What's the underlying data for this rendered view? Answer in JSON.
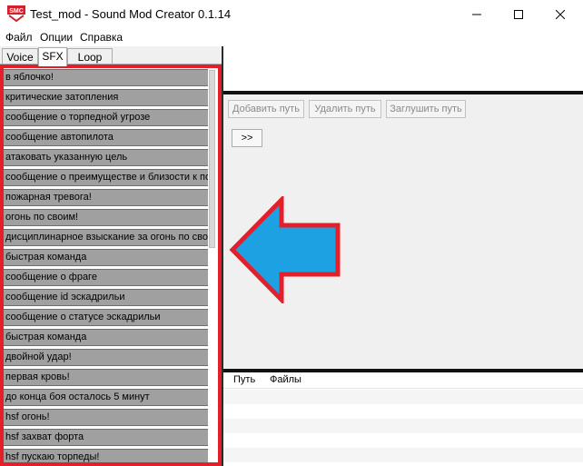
{
  "window": {
    "app_icon_text": "SMC",
    "title": "Test_mod - Sound Mod Creator 0.1.14"
  },
  "menu": [
    "Файл",
    "Опции",
    "Справка"
  ],
  "tabs": [
    {
      "label": "Voice",
      "active": false
    },
    {
      "label": "SFX",
      "active": true
    },
    {
      "label": "Loop",
      "active": false
    }
  ],
  "list_items": [
    "в яблочко!",
    "критические затопления",
    "сообщение о торпедной угрозе",
    "сообщение автопилота",
    "атаковать указанную цель",
    "сообщение о преимуществе и близости к пол",
    "пожарная тревога!",
    "огонь по своим!",
    "дисциплинарное взыскание за огонь по свои",
    "быстрая команда",
    "сообщение о фраге",
    "сообщение id эскадрильи",
    "сообщение о статусе эскадрильи",
    "быстрая команда",
    "двойной удар!",
    "первая кровь!",
    "до конца боя осталось 5 минут",
    "hsf огонь!",
    "hsf захват форта",
    "hsf пускаю торпеды!"
  ],
  "actions": {
    "add_path": "Добавить путь",
    "remove_path": "Удалить путь",
    "mute_path": "Заглушить путь",
    "go": ">>"
  },
  "table": {
    "columns": [
      "Путь",
      "Файлы"
    ]
  },
  "colors": {
    "highlight": "#e3202a",
    "arrow_fill": "#1da1e2",
    "arrow_stroke": "#e3202a"
  }
}
